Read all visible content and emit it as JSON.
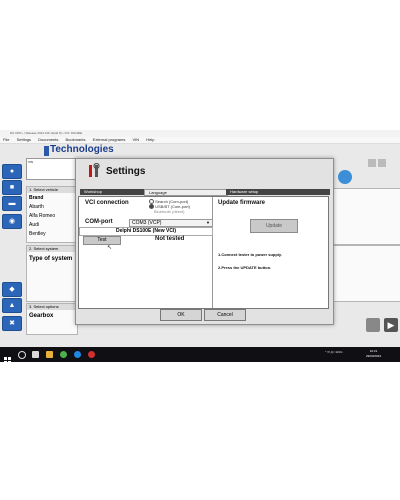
{
  "window": {
    "title": "DS CDP+ / Release 2021.10b (build 8) • VCI: DS100E",
    "menu": [
      "File",
      "Settings",
      "Documents",
      "Bookmarks",
      "External programs",
      "VIN",
      "Help"
    ]
  },
  "header": {
    "logo_text": "Technologies",
    "vin_label": "VIN"
  },
  "panels": {
    "select_vehicle": {
      "header": "1. Select vehicle",
      "brand_label": "Brand",
      "brands": [
        "Abarth",
        "Alfa Romeo",
        "Audi",
        "Bentley"
      ]
    },
    "select_system": {
      "header": "2. Select system",
      "type_label": "Type of system"
    },
    "select_options": {
      "header": "3. Select options",
      "gearbox_label": "Gearbox"
    }
  },
  "dialog": {
    "title": "Settings",
    "tabs": [
      "Workshop",
      "Language",
      "Hardware setup"
    ],
    "vci": {
      "label": "VCI connection",
      "options": [
        "Search (Com-port)",
        "USB/BT (Com-port)",
        "Bluetooth (direct)"
      ],
      "com_label": "COM-port",
      "com_value": "COM3 (VCP)",
      "device": "Delphi DS100E (New VCI)",
      "test_button": "Test",
      "test_status": "Not tested"
    },
    "firmware": {
      "label": "Update firmware",
      "update_button": "Update",
      "instructions": [
        "1.Connect tester to power supply.",
        "2.Press the UPDATE button."
      ]
    },
    "ok_button": "OK",
    "cancel_button": "Cancel"
  },
  "taskbar": {
    "tray_text": "^ ✉ Д □ ENG",
    "time": "10:21",
    "date": "29/03/2023"
  },
  "colors": {
    "accent_blue": "#2b66b8",
    "logo_blue": "#1a3c8c",
    "tab_dark": "#444444"
  }
}
